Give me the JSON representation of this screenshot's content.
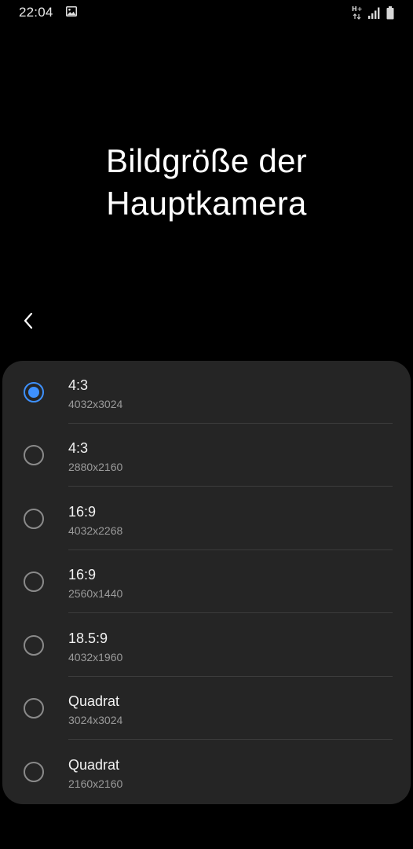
{
  "status_bar": {
    "time": "22:04",
    "network_label": "H+",
    "icons": [
      "gallery-icon",
      "network-type-icon",
      "signal-icon",
      "battery-icon"
    ]
  },
  "page": {
    "title_line1": "Bildgröße der",
    "title_line2": "Hauptkamera"
  },
  "back_icon": "chevron-left-icon",
  "accent_color": "#3e91ff",
  "options": [
    {
      "label": "4:3",
      "resolution": "4032x3024",
      "selected": true
    },
    {
      "label": "4:3",
      "resolution": "2880x2160",
      "selected": false
    },
    {
      "label": "16:9",
      "resolution": "4032x2268",
      "selected": false
    },
    {
      "label": "16:9",
      "resolution": "2560x1440",
      "selected": false
    },
    {
      "label": "18.5:9",
      "resolution": "4032x1960",
      "selected": false
    },
    {
      "label": "Quadrat",
      "resolution": "3024x3024",
      "selected": false
    },
    {
      "label": "Quadrat",
      "resolution": "2160x2160",
      "selected": false
    }
  ]
}
